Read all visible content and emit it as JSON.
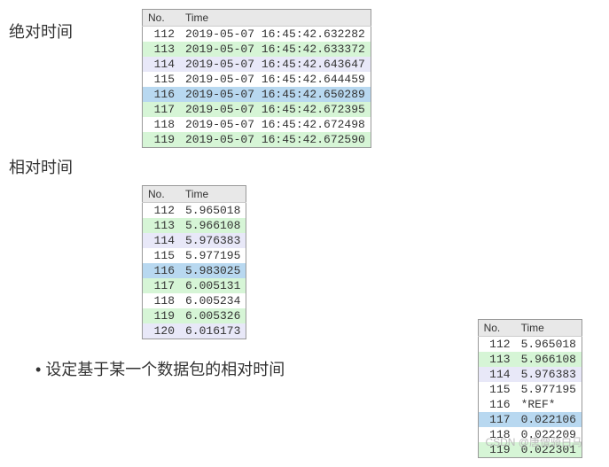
{
  "labels": {
    "absolute": "绝对时间",
    "relative": "相对时间",
    "bullet": "设定基于某一个数据包的相对时间",
    "no_header": "No.",
    "time_header": "Time"
  },
  "abs_table": [
    {
      "no": "112",
      "time": "2019-05-07 16:45:42.632282",
      "cls": "row-white"
    },
    {
      "no": "113",
      "time": "2019-05-07 16:45:42.633372",
      "cls": "row-green"
    },
    {
      "no": "114",
      "time": "2019-05-07 16:45:42.643647",
      "cls": "row-lav"
    },
    {
      "no": "115",
      "time": "2019-05-07 16:45:42.644459",
      "cls": "row-white"
    },
    {
      "no": "116",
      "time": "2019-05-07 16:45:42.650289",
      "cls": "row-blue"
    },
    {
      "no": "117",
      "time": "2019-05-07 16:45:42.672395",
      "cls": "row-green"
    },
    {
      "no": "118",
      "time": "2019-05-07 16:45:42.672498",
      "cls": "row-white"
    },
    {
      "no": "119",
      "time": "2019-05-07 16:45:42.672590",
      "cls": "row-green"
    }
  ],
  "rel_table": [
    {
      "no": "112",
      "time": "5.965018",
      "cls": "row-white"
    },
    {
      "no": "113",
      "time": "5.966108",
      "cls": "row-green"
    },
    {
      "no": "114",
      "time": "5.976383",
      "cls": "row-lav"
    },
    {
      "no": "115",
      "time": "5.977195",
      "cls": "row-white"
    },
    {
      "no": "116",
      "time": "5.983025",
      "cls": "row-blue"
    },
    {
      "no": "117",
      "time": "6.005131",
      "cls": "row-green"
    },
    {
      "no": "118",
      "time": "6.005234",
      "cls": "row-white"
    },
    {
      "no": "119",
      "time": "6.005326",
      "cls": "row-green"
    },
    {
      "no": "120",
      "time": "6.016173",
      "cls": "row-lav"
    }
  ],
  "ref_table": [
    {
      "no": "112",
      "time": "5.965018",
      "cls": "row-white"
    },
    {
      "no": "113",
      "time": "5.966108",
      "cls": "row-green"
    },
    {
      "no": "114",
      "time": "5.976383",
      "cls": "row-lav"
    },
    {
      "no": "115",
      "time": "5.977195",
      "cls": "row-white"
    },
    {
      "no": "116",
      "time": "*REF*",
      "cls": "row-white"
    },
    {
      "no": "117",
      "time": "0.022106",
      "cls": "row-blue"
    },
    {
      "no": "118",
      "time": "0.022209",
      "cls": "row-white"
    },
    {
      "no": "119",
      "time": "0.022301",
      "cls": "row-green"
    }
  ],
  "watermark": "CSDN @唐僧骑白马"
}
